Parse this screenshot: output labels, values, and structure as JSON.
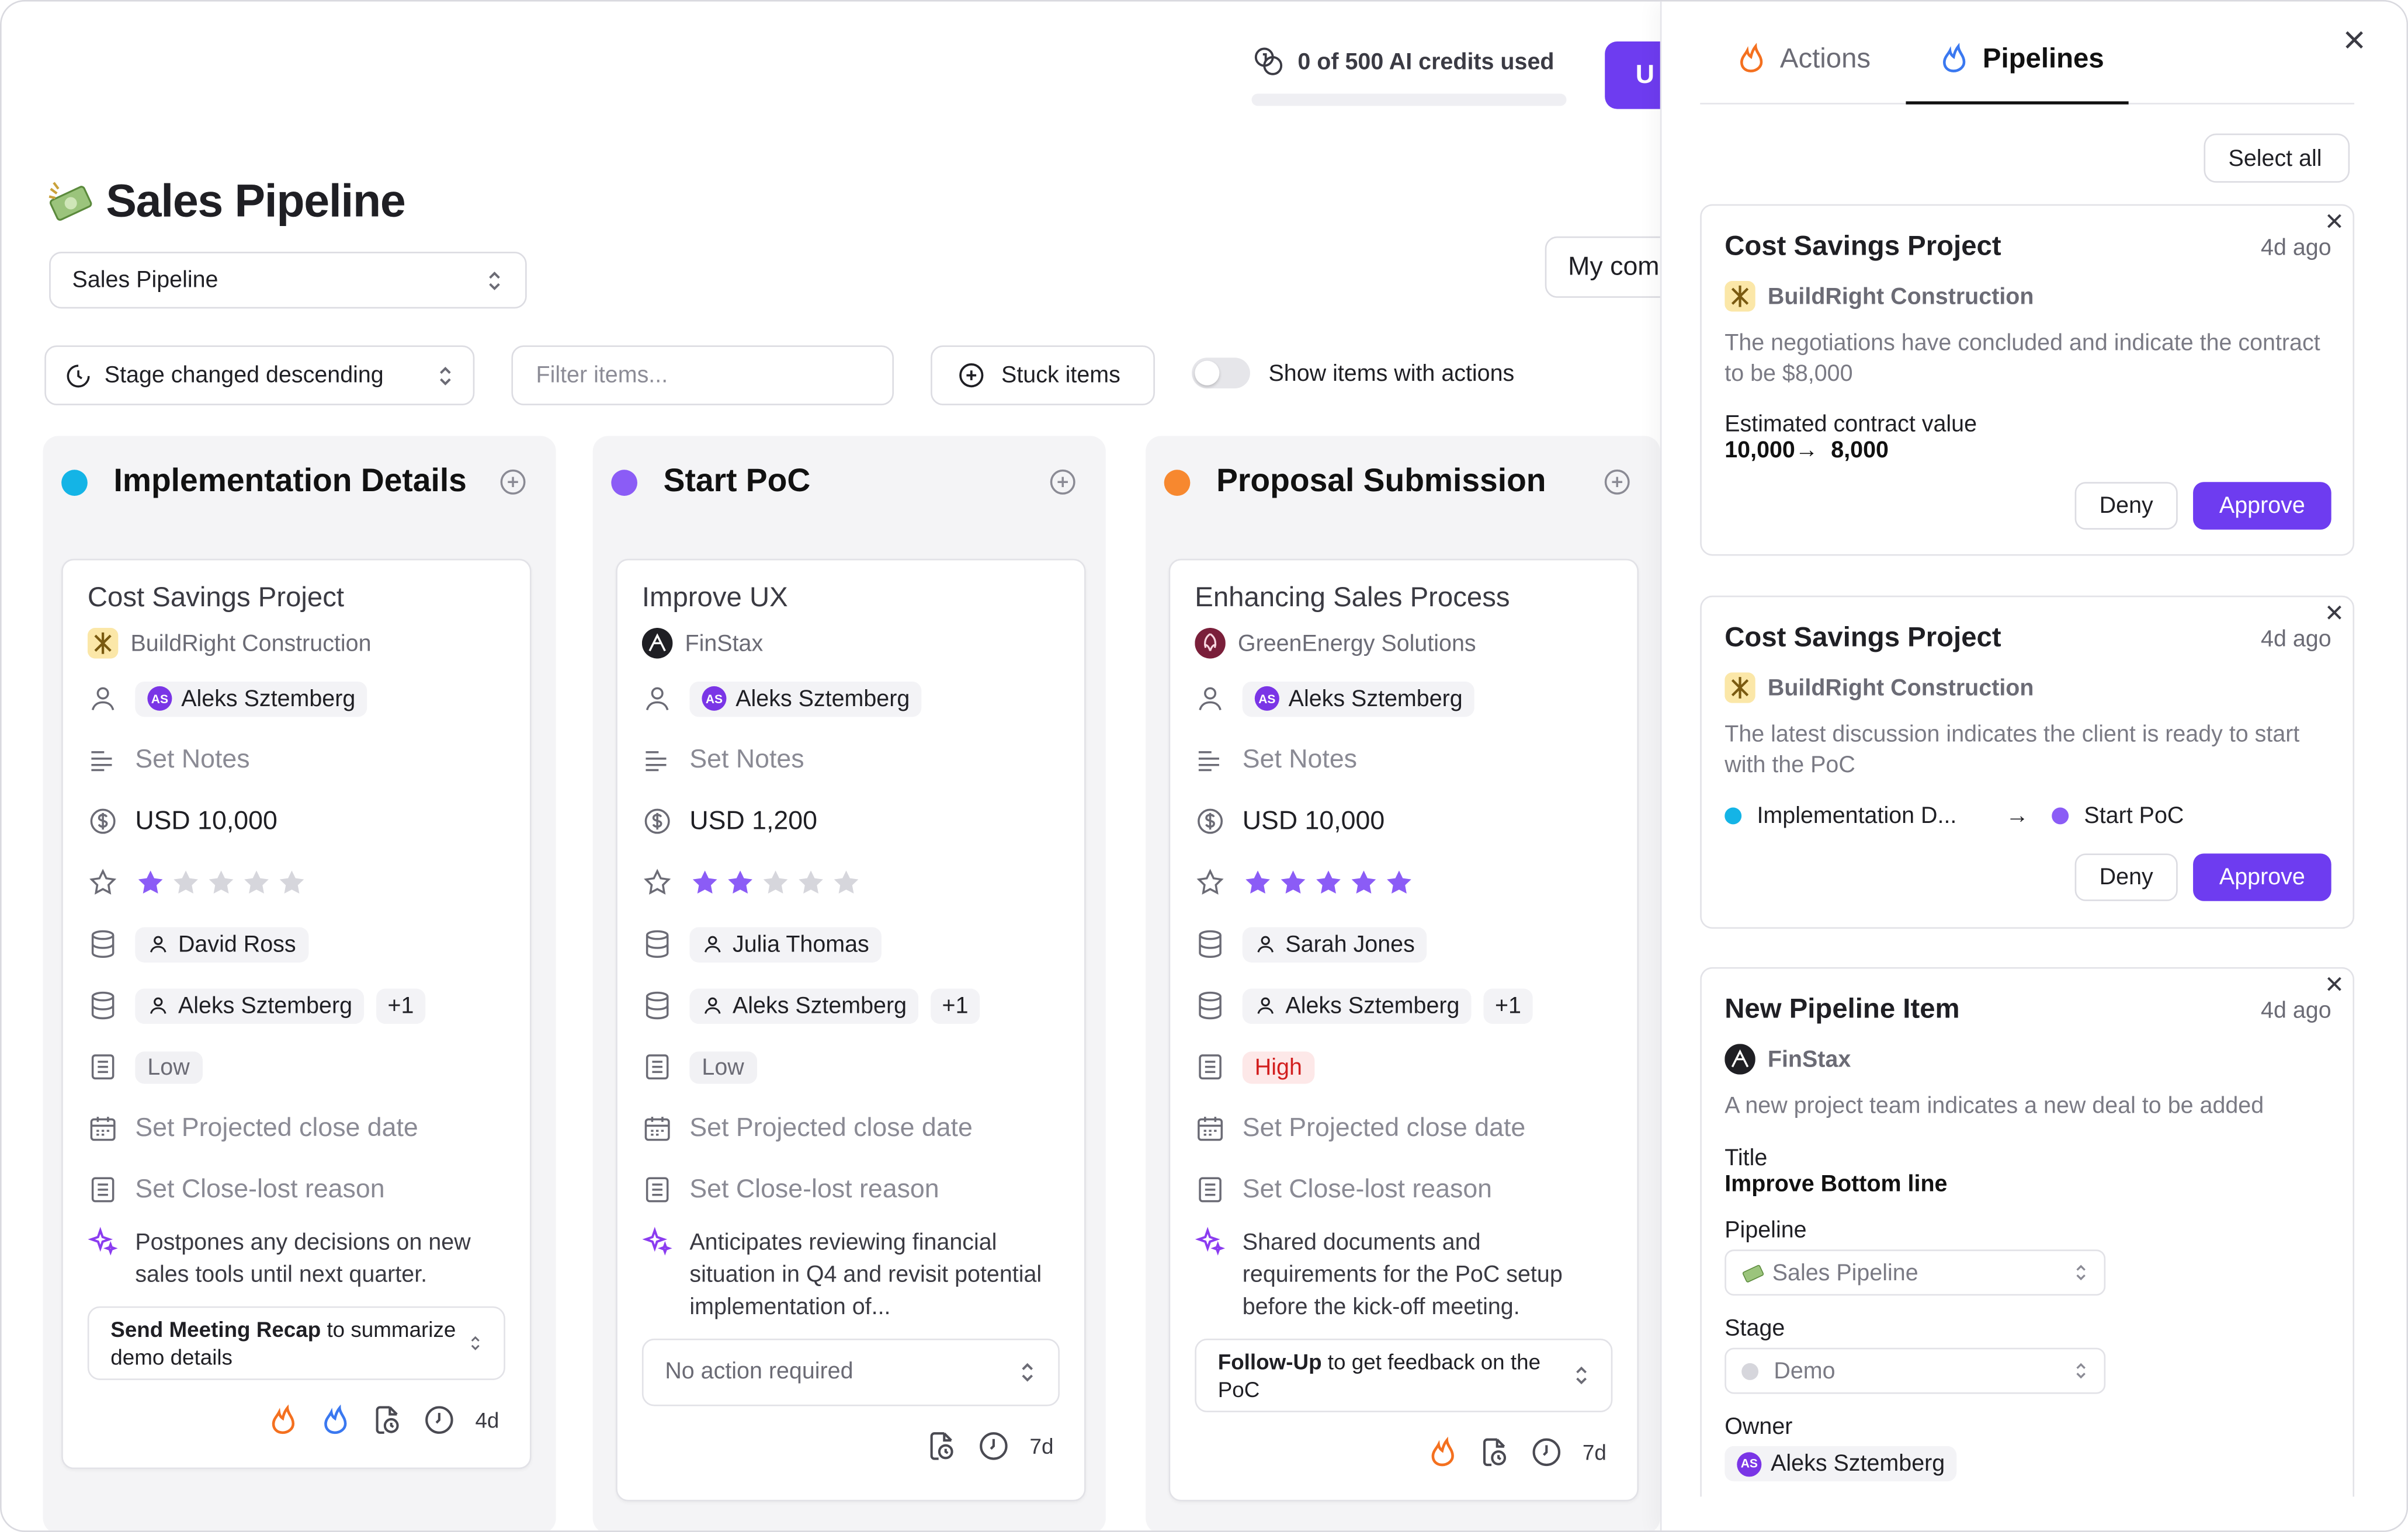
{
  "header": {
    "credits_text": "0 of 500 AI credits used",
    "upgrade_label": "U",
    "page_title": "Sales Pipeline",
    "pipeline_select": "Sales Pipeline",
    "my_companies": "My com"
  },
  "toolbar": {
    "sort_label": "Stage changed descending",
    "filter_placeholder": "Filter items...",
    "stuck_label": "Stuck items",
    "toggle_label": "Show items with actions"
  },
  "colors": {
    "accent": "#6e3cf0",
    "implementation": "#14b4e6",
    "start_poc": "#8b5cf6",
    "proposal": "#f7882f",
    "demo": "#d6d6dc"
  },
  "columns": [
    {
      "title": "Implementation Details",
      "card": {
        "title": "Cost Savings Project",
        "company": "BuildRight Construction",
        "owner": "Aleks Sztemberg",
        "notes": "Set Notes",
        "value": "USD 10,000",
        "rating": 1,
        "contact": "David Ross",
        "team": "Aleks Sztemberg",
        "team_extra": "+1",
        "priority": "Low",
        "close_date": "Set Projected close date",
        "close_lost": "Set Close-lost reason",
        "ai_note": "Postpones any decisions on new sales tools until next quarter.",
        "action_bold": "Send Meeting Recap",
        "action_rest": " to summarize demo details",
        "age": "4d"
      }
    },
    {
      "title": "Start PoC",
      "card": {
        "title": "Improve UX",
        "company": "FinStax",
        "owner": "Aleks Sztemberg",
        "notes": "Set Notes",
        "value": "USD 1,200",
        "rating": 2,
        "contact": "Julia Thomas",
        "team": "Aleks Sztemberg",
        "team_extra": "+1",
        "priority": "Low",
        "close_date": "Set Projected close date",
        "close_lost": "Set Close-lost reason",
        "ai_note": "Anticipates reviewing financial situation in Q4 and revisit potential implementation of...",
        "action_plain": "No action required",
        "age": "7d"
      }
    },
    {
      "title": "Proposal Submission",
      "card": {
        "title": "Enhancing Sales Process",
        "company": "GreenEnergy Solutions",
        "owner": "Aleks Sztemberg",
        "notes": "Set Notes",
        "value": "USD 10,000",
        "rating": 5,
        "contact": "Sarah Jones",
        "team": "Aleks Sztemberg",
        "team_extra": "+1",
        "priority": "High",
        "close_date": "Set Projected close date",
        "close_lost": "Set Close-lost reason",
        "ai_note": "Shared documents and requirements for the PoC setup before the kick-off meeting.",
        "action_bold": "Follow-Up",
        "action_rest": " to get feedback on the PoC",
        "age": "7d"
      }
    }
  ],
  "panel": {
    "tab_actions": "Actions",
    "tab_pipelines": "Pipelines",
    "select_all": "Select all",
    "deny": "Deny",
    "approve": "Approve",
    "suggestions": [
      {
        "title": "Cost Savings Project",
        "ago": "4d ago",
        "company": "BuildRight Construction",
        "desc": "The negotiations have concluded and indicate the contract to be $8,000",
        "label": "Estimated contract value",
        "from": "10,000",
        "arrow": "→",
        "to": "8,000"
      },
      {
        "title": "Cost Savings Project",
        "ago": "4d ago",
        "company": "BuildRight Construction",
        "desc": "The latest discussion indicates the client is ready to start with the PoC",
        "from_stage": "Implementation D...",
        "arrow": "→",
        "to_stage": "Start PoC"
      },
      {
        "title": "New Pipeline Item",
        "ago": "4d ago",
        "company": "FinStax",
        "desc": "A new project team indicates a new deal to be added",
        "title_label": "Title",
        "title_value": "Improve Bottom line",
        "pipeline_label": "Pipeline",
        "pipeline_value": "Sales Pipeline",
        "stage_label": "Stage",
        "stage_value": "Demo",
        "owner_label": "Owner",
        "owner_value": "Aleks Sztemberg"
      }
    ]
  }
}
